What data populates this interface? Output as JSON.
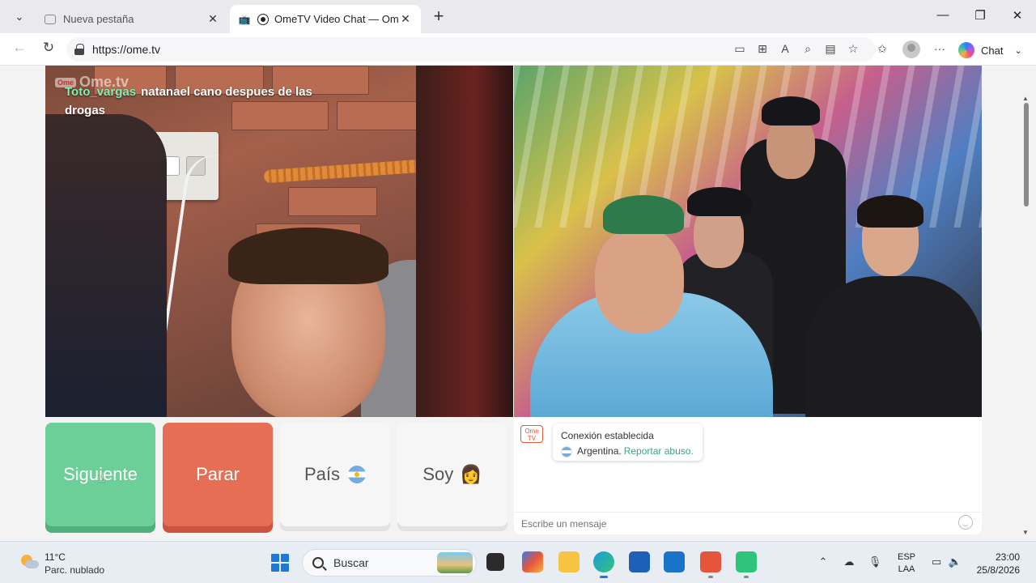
{
  "browser": {
    "tabs": [
      {
        "label": "Nueva pestaña",
        "active": false
      },
      {
        "label": "OmeTV Video Chat — Omegl",
        "active": true
      }
    ],
    "url": "https://ome.tv",
    "chat_label": "Chat"
  },
  "video": {
    "logo_text": "Ome.tv",
    "logo_badge": "Ome",
    "caption_user": "Toto_vargas",
    "caption_text": "natanael cano despues de las drogas"
  },
  "controls": {
    "next_label": "Siguiente",
    "stop_label": "Parar",
    "country_label": "País",
    "me_label": "Soy",
    "me_emoji": "👩"
  },
  "chat": {
    "logo_text": "Ome TV",
    "status": "Conexión establecida",
    "country": "Argentina.",
    "report_link": "Reportar abuso.",
    "input_placeholder": "Escribe un mensaje"
  },
  "taskbar": {
    "temperature": "11°C",
    "weather": "Parc. nublado",
    "search_placeholder": "Buscar",
    "lang_top": "ESP",
    "lang_bottom": "LAA",
    "time": "23:00",
    "date": "25/8/2026"
  }
}
